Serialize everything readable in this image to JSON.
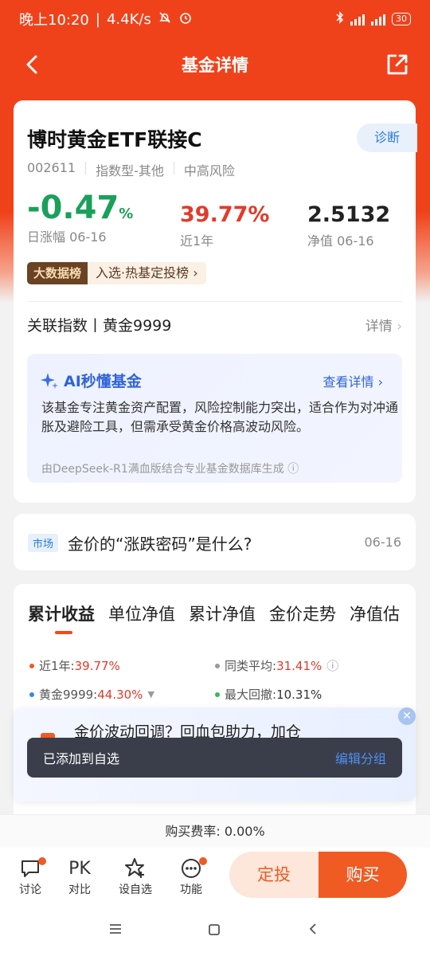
{
  "status": {
    "time": "晚上10:20",
    "speed": "4.4K/s",
    "battery": "30"
  },
  "nav": {
    "title": "基金详情"
  },
  "fund": {
    "name": "博时黄金ETF联接C",
    "diagnose": "诊断",
    "code": "002611",
    "type": "指数型-其他",
    "risk": "中高风险",
    "daily_change": "-0.47",
    "daily_change_unit": "%",
    "daily_label": "日涨幅 06-16",
    "year_return": "39.77%",
    "year_label": "近1年",
    "nav_value": "2.5132",
    "nav_label": "净值 06-16",
    "rank_tag": "大数据榜",
    "rank_text": "入选·热基定投榜"
  },
  "index_row": {
    "label": "关联指数丨黄金9999",
    "more": "详情"
  },
  "ai": {
    "title": "AI秒懂基金",
    "more": "查看详情",
    "text": "该基金专注黄金资产配置，风险控制能力突出，适合作为对冲通胀及避险工具，但需承受黄金价格高波动风险。",
    "source": "由DeepSeek-R1满血版结合专业基金数据库生成"
  },
  "news": {
    "tag": "市场",
    "title": "金价的“涨跌密码”是什么?",
    "date": "06-16"
  },
  "chart_tabs": [
    "累计收益",
    "单位净值",
    "累计净值",
    "金价走势",
    "净值估"
  ],
  "legend": {
    "year": {
      "label": "近1年:",
      "value": "39.77%"
    },
    "peer": {
      "label": "同类平均:",
      "value": "31.41%"
    },
    "index": {
      "label": "黄金9999:",
      "value": "44.30%"
    },
    "drawdown": {
      "label": "最大回撤:",
      "value": "10.31%"
    }
  },
  "promo": {
    "text": "金价波动回调？回血包助力，加仓"
  },
  "toast": {
    "text": "已添加到自选",
    "action": "编辑分组"
  },
  "fee": {
    "text": "购买费率: 0.00%"
  },
  "bottom": {
    "discuss": "讨论",
    "compare_icon": "PK",
    "compare": "对比",
    "watchlist": "设自选",
    "functions": "功能",
    "sip": "定投",
    "buy": "购买"
  },
  "colors": {
    "brand": "#f0421a",
    "up": "#e33a2b",
    "down": "#1aa05a",
    "link": "#2f63d8"
  }
}
